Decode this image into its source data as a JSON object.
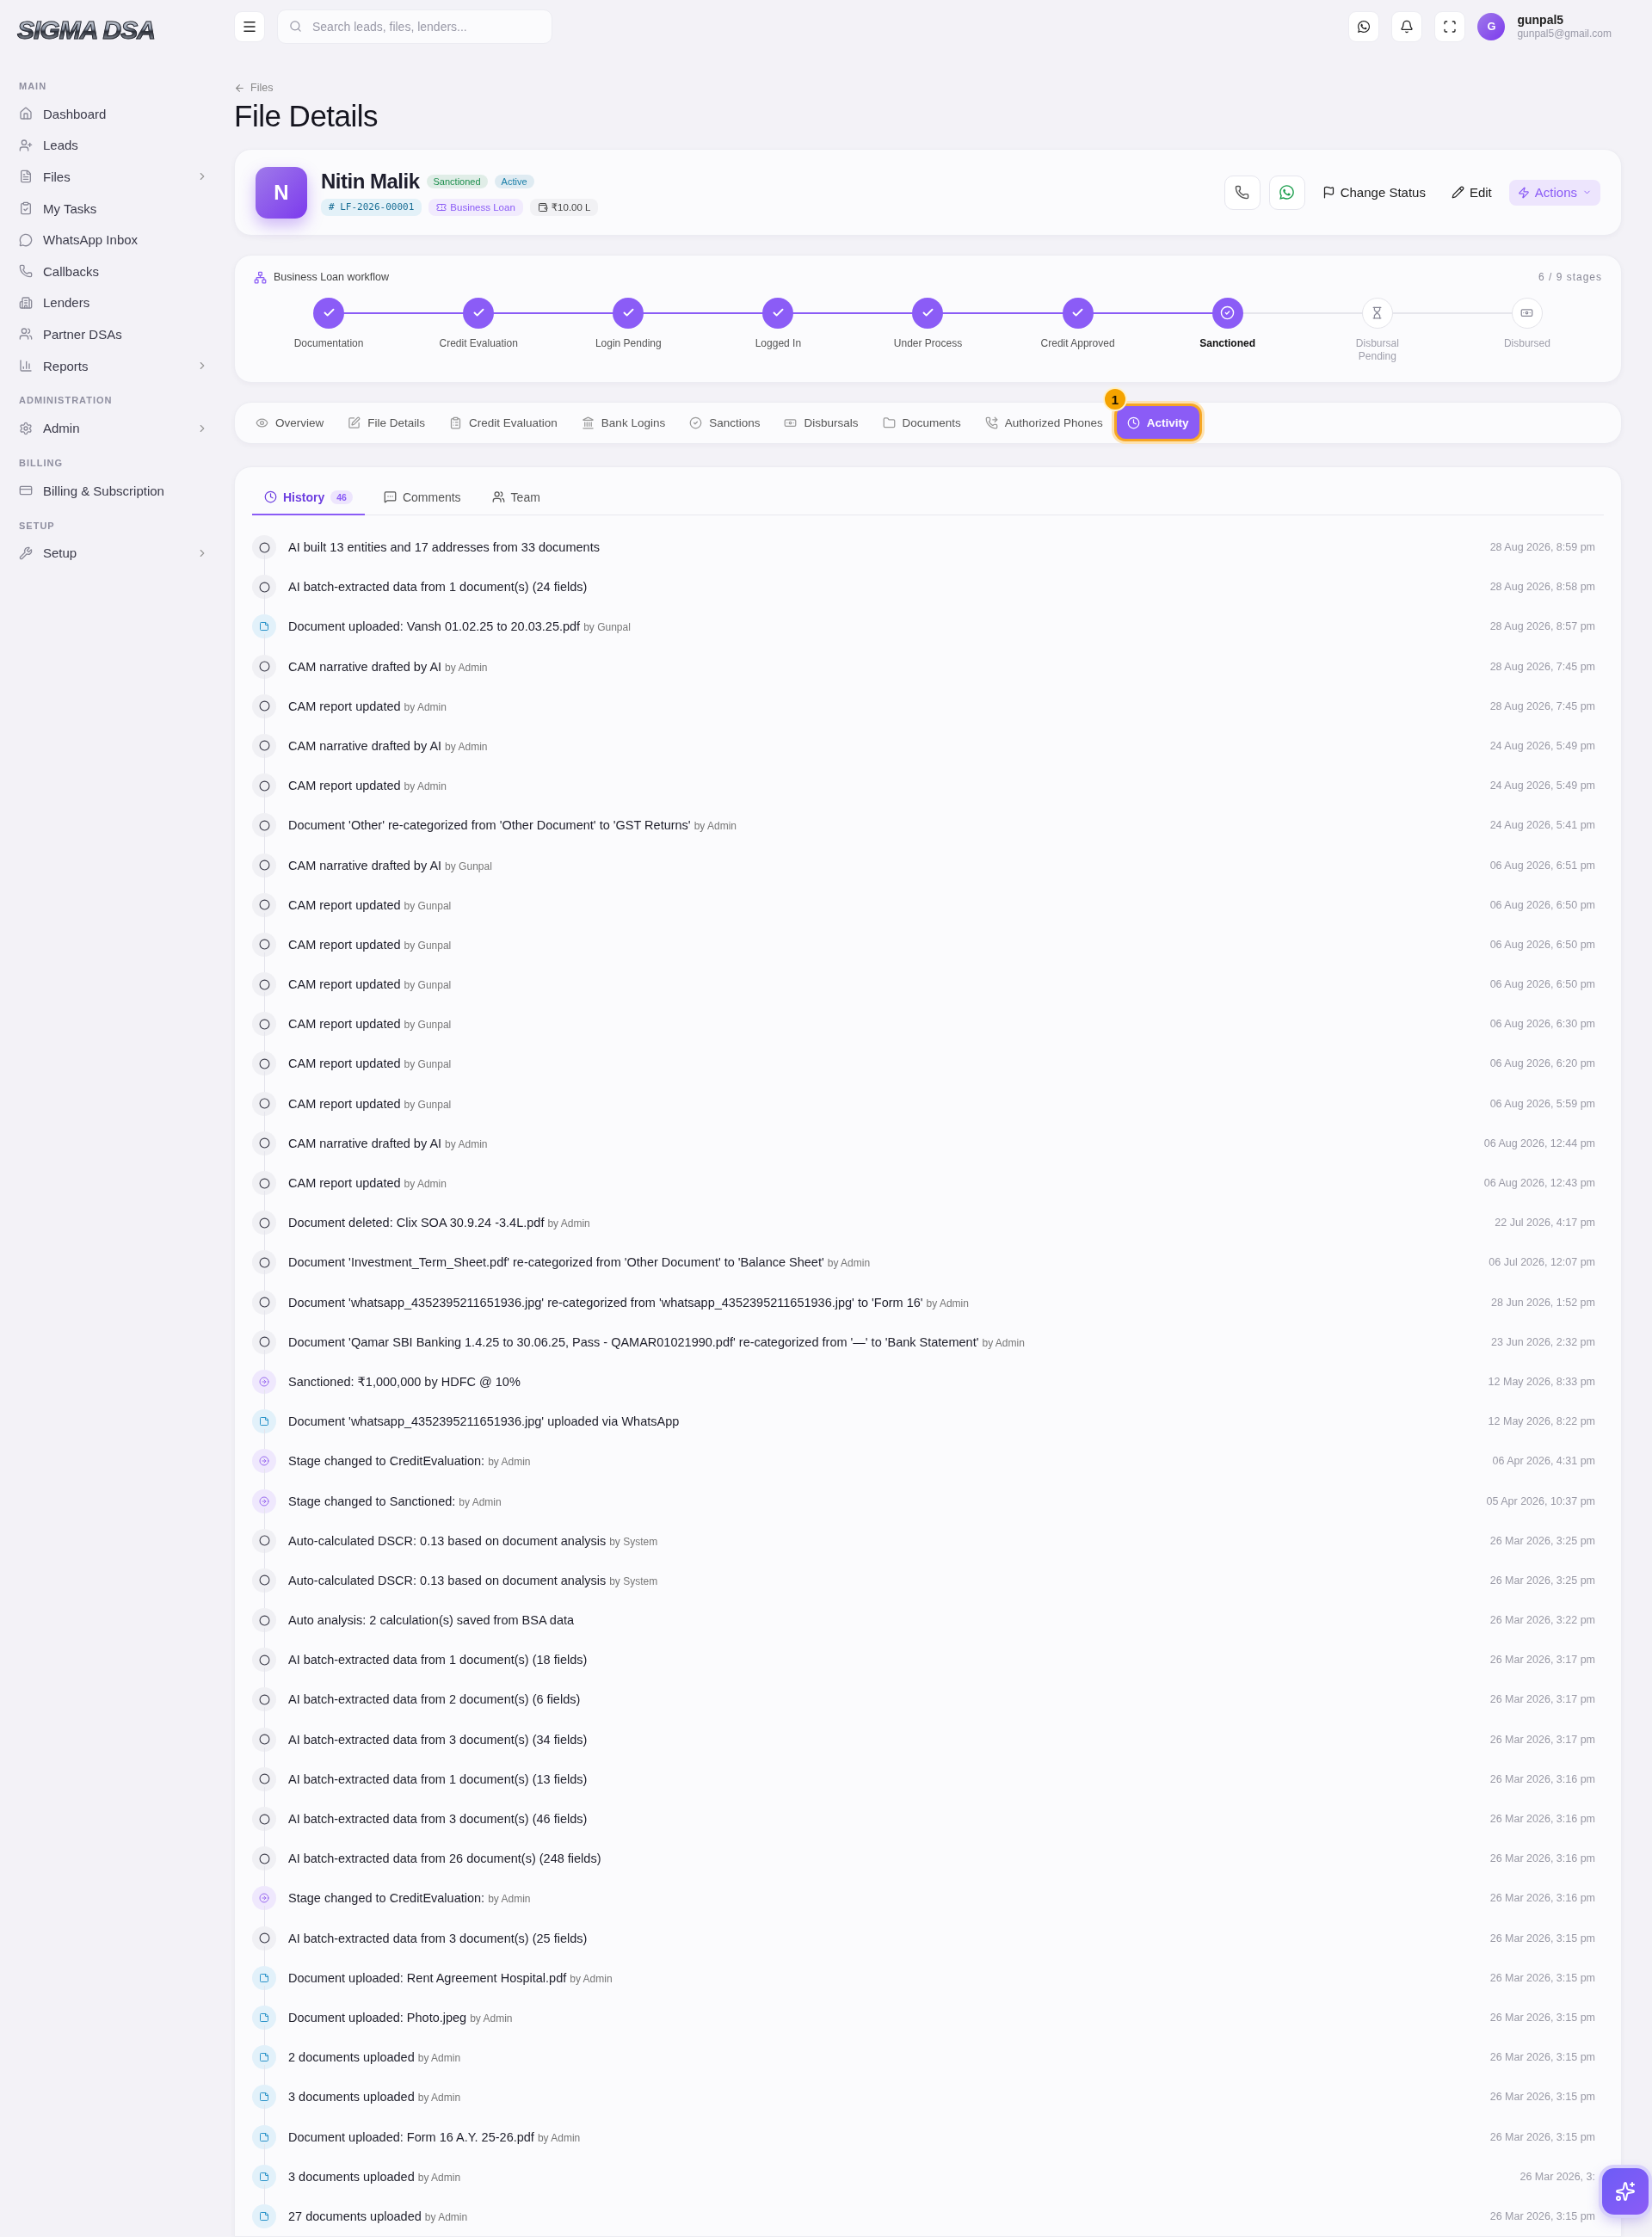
{
  "logo": "SIGMA DSA",
  "topbar": {
    "search_placeholder": "Search leads, files, lenders...",
    "user": {
      "initial": "G",
      "name": "gunpal5",
      "email": "gunpal5@gmail.com"
    }
  },
  "sidebar": {
    "sections": [
      {
        "title": "MAIN",
        "items": [
          {
            "label": "Dashboard",
            "has_submenu": false
          },
          {
            "label": "Leads",
            "has_submenu": false
          },
          {
            "label": "Files",
            "has_submenu": true
          },
          {
            "label": "My Tasks",
            "has_submenu": false
          },
          {
            "label": "WhatsApp Inbox",
            "has_submenu": false
          },
          {
            "label": "Callbacks",
            "has_submenu": false
          },
          {
            "label": "Lenders",
            "has_submenu": false
          },
          {
            "label": "Partner DSAs",
            "has_submenu": false
          },
          {
            "label": "Reports",
            "has_submenu": true
          }
        ]
      },
      {
        "title": "ADMINISTRATION",
        "items": [
          {
            "label": "Admin",
            "has_submenu": true
          }
        ]
      },
      {
        "title": "BILLING",
        "items": [
          {
            "label": "Billing & Subscription",
            "has_submenu": false
          }
        ]
      },
      {
        "title": "SETUP",
        "items": [
          {
            "label": "Setup",
            "has_submenu": true
          }
        ]
      }
    ]
  },
  "breadcrumb": "Files",
  "page_title": "File Details",
  "profile": {
    "initial": "N",
    "name": "Nitin Malik",
    "badges": [
      {
        "label": "Sanctioned",
        "color": "#1e8f4e"
      },
      {
        "label": "Active",
        "color": "#1a7fa8"
      }
    ],
    "meta": [
      {
        "kind": "id",
        "label": "# LF-2026-00001"
      },
      {
        "kind": "loan",
        "label": "Business Loan"
      },
      {
        "kind": "amount",
        "label": "₹10.00 L"
      }
    ],
    "actions": [
      {
        "kind": "call"
      },
      {
        "kind": "whatsapp"
      },
      {
        "kind": "status",
        "label": "Change Status"
      },
      {
        "kind": "edit",
        "label": "Edit"
      },
      {
        "kind": "menu",
        "label": "Actions"
      }
    ]
  },
  "workflow": {
    "title": "Business Loan workflow",
    "progress": "6 / 9 stages",
    "stages": [
      {
        "label": "Documentation",
        "kind": "done"
      },
      {
        "label": "Credit Evaluation",
        "kind": "done"
      },
      {
        "label": "Login Pending",
        "kind": "done"
      },
      {
        "label": "Logged In",
        "kind": "done"
      },
      {
        "label": "Under Process",
        "kind": "done"
      },
      {
        "label": "Credit Approved",
        "kind": "done"
      },
      {
        "label": "Sanctioned",
        "kind": "current"
      },
      {
        "label": "Disbursal Pending",
        "kind": "pending"
      },
      {
        "label": "Disbursed",
        "kind": "pending"
      }
    ]
  },
  "tabs": [
    {
      "label": "Overview",
      "selected": false
    },
    {
      "label": "File Details",
      "selected": false
    },
    {
      "label": "Credit Evaluation",
      "selected": false
    },
    {
      "label": "Bank Logins",
      "selected": false
    },
    {
      "label": "Sanctions",
      "selected": false
    },
    {
      "label": "Disbursals",
      "selected": false
    },
    {
      "label": "Documents",
      "selected": false
    },
    {
      "label": "Authorized Phones",
      "selected": false
    },
    {
      "label": "Activity",
      "selected": true,
      "step": "1"
    }
  ],
  "activity": {
    "tabs": [
      {
        "label": "History",
        "count": "46",
        "selected": true
      },
      {
        "label": "Comments",
        "selected": false
      },
      {
        "label": "Team",
        "selected": false
      }
    ],
    "entries": [
      {
        "kind": "event",
        "text": "AI built 13 entities and 17 addresses from 33 documents",
        "time": "28 Aug 2026, 8:59 pm"
      },
      {
        "kind": "event",
        "text": "AI batch-extracted data from 1 document(s) (24 fields)",
        "time": "28 Aug 2026, 8:58 pm"
      },
      {
        "kind": "document",
        "text": "Document uploaded: Vansh 01.02.25 to 20.03.25.pdf",
        "actor": "by Gunpal",
        "time": "28 Aug 2026, 8:57 pm"
      },
      {
        "kind": "event",
        "text": "CAM narrative drafted by AI",
        "actor": "by Admin",
        "time": "28 Aug 2026, 7:45 pm"
      },
      {
        "kind": "event",
        "text": "CAM report updated",
        "actor": "by Admin",
        "time": "28 Aug 2026, 7:45 pm"
      },
      {
        "kind": "event",
        "text": "CAM narrative drafted by AI",
        "actor": "by Admin",
        "time": "24 Aug 2026, 5:49 pm"
      },
      {
        "kind": "event",
        "text": "CAM report updated",
        "actor": "by Admin",
        "time": "24 Aug 2026, 5:49 pm"
      },
      {
        "kind": "event",
        "text": "Document 'Other' re-categorized from 'Other Document' to 'GST Returns'",
        "actor": "by Admin",
        "time": "24 Aug 2026, 5:41 pm"
      },
      {
        "kind": "event",
        "text": "CAM narrative drafted by AI",
        "actor": "by Gunpal",
        "time": "06 Aug 2026, 6:51 pm"
      },
      {
        "kind": "event",
        "text": "CAM report updated",
        "actor": "by Gunpal",
        "time": "06 Aug 2026, 6:50 pm"
      },
      {
        "kind": "event",
        "text": "CAM report updated",
        "actor": "by Gunpal",
        "time": "06 Aug 2026, 6:50 pm"
      },
      {
        "kind": "event",
        "text": "CAM report updated",
        "actor": "by Gunpal",
        "time": "06 Aug 2026, 6:50 pm"
      },
      {
        "kind": "event",
        "text": "CAM report updated",
        "actor": "by Gunpal",
        "time": "06 Aug 2026, 6:30 pm"
      },
      {
        "kind": "event",
        "text": "CAM report updated",
        "actor": "by Gunpal",
        "time": "06 Aug 2026, 6:20 pm"
      },
      {
        "kind": "event",
        "text": "CAM report updated",
        "actor": "by Gunpal",
        "time": "06 Aug 2026, 5:59 pm"
      },
      {
        "kind": "event",
        "text": "CAM narrative drafted by AI",
        "actor": "by Admin",
        "time": "06 Aug 2026, 12:44 pm"
      },
      {
        "kind": "event",
        "text": "CAM report updated",
        "actor": "by Admin",
        "time": "06 Aug 2026, 12:43 pm"
      },
      {
        "kind": "event",
        "text": "Document deleted: Clix SOA 30.9.24 -3.4L.pdf",
        "actor": "by Admin",
        "time": "22 Jul 2026, 4:17 pm"
      },
      {
        "kind": "event",
        "text": "Document 'Investment_Term_Sheet.pdf' re-categorized from 'Other Document' to 'Balance Sheet'",
        "actor": "by Admin",
        "time": "06 Jul 2026, 12:07 pm"
      },
      {
        "kind": "event",
        "text": "Document 'whatsapp_4352395211651936.jpg' re-categorized from 'whatsapp_4352395211651936.jpg' to 'Form 16'",
        "actor": "by Admin",
        "time": "28 Jun 2026, 1:52 pm"
      },
      {
        "kind": "event",
        "text": "Document 'Qamar SBI Banking 1.4.25 to 30.06.25, Pass - QAMAR01021990.pdf' re-categorized from '—' to 'Bank Statement'",
        "actor": "by Admin",
        "time": "23 Jun 2026, 2:32 pm"
      },
      {
        "kind": "stage",
        "text": "Sanctioned: ₹1,000,000 by HDFC @ 10%",
        "time": "12 May 2026, 8:33 pm"
      },
      {
        "kind": "document",
        "text": "Document 'whatsapp_4352395211651936.jpg' uploaded via WhatsApp",
        "time": "12 May 2026, 8:22 pm"
      },
      {
        "kind": "stage",
        "text": "Stage changed to CreditEvaluation:",
        "actor": "by Admin",
        "time": "06 Apr 2026, 4:31 pm"
      },
      {
        "kind": "stage",
        "text": "Stage changed to Sanctioned:",
        "actor": "by Admin",
        "time": "05 Apr 2026, 10:37 pm"
      },
      {
        "kind": "event",
        "text": "Auto-calculated DSCR: 0.13 based on document analysis",
        "actor": "by System",
        "time": "26 Mar 2026, 3:25 pm"
      },
      {
        "kind": "event",
        "text": "Auto-calculated DSCR: 0.13 based on document analysis",
        "actor": "by System",
        "time": "26 Mar 2026, 3:25 pm"
      },
      {
        "kind": "event",
        "text": "Auto analysis: 2 calculation(s) saved from BSA data",
        "time": "26 Mar 2026, 3:22 pm"
      },
      {
        "kind": "event",
        "text": "AI batch-extracted data from 1 document(s) (18 fields)",
        "time": "26 Mar 2026, 3:17 pm"
      },
      {
        "kind": "event",
        "text": "AI batch-extracted data from 2 document(s) (6 fields)",
        "time": "26 Mar 2026, 3:17 pm"
      },
      {
        "kind": "event",
        "text": "AI batch-extracted data from 3 document(s) (34 fields)",
        "time": "26 Mar 2026, 3:17 pm"
      },
      {
        "kind": "event",
        "text": "AI batch-extracted data from 1 document(s) (13 fields)",
        "time": "26 Mar 2026, 3:16 pm"
      },
      {
        "kind": "event",
        "text": "AI batch-extracted data from 3 document(s) (46 fields)",
        "time": "26 Mar 2026, 3:16 pm"
      },
      {
        "kind": "event",
        "text": "AI batch-extracted data from 26 document(s) (248 fields)",
        "time": "26 Mar 2026, 3:16 pm"
      },
      {
        "kind": "stage",
        "text": "Stage changed to CreditEvaluation:",
        "actor": "by Admin",
        "time": "26 Mar 2026, 3:16 pm"
      },
      {
        "kind": "event",
        "text": "AI batch-extracted data from 3 document(s) (25 fields)",
        "time": "26 Mar 2026, 3:15 pm"
      },
      {
        "kind": "document",
        "text": "Document uploaded: Rent Agreement Hospital.pdf",
        "actor": "by Admin",
        "time": "26 Mar 2026, 3:15 pm"
      },
      {
        "kind": "document",
        "text": "Document uploaded: Photo.jpeg",
        "actor": "by Admin",
        "time": "26 Mar 2026, 3:15 pm"
      },
      {
        "kind": "document",
        "text": "2 documents uploaded",
        "actor": "by Admin",
        "time": "26 Mar 2026, 3:15 pm"
      },
      {
        "kind": "document",
        "text": "3 documents uploaded",
        "actor": "by Admin",
        "time": "26 Mar 2026, 3:15 pm"
      },
      {
        "kind": "document",
        "text": "Document uploaded: Form 16 A.Y. 25-26.pdf",
        "actor": "by Admin",
        "time": "26 Mar 2026, 3:15 pm"
      },
      {
        "kind": "document",
        "text": "3 documents uploaded",
        "actor": "by Admin",
        "time": "26 Mar 2026, 3:"
      },
      {
        "kind": "document",
        "text": "27 documents uploaded",
        "actor": "by Admin",
        "time": "26 Mar 2026, 3:15 pm"
      }
    ]
  }
}
